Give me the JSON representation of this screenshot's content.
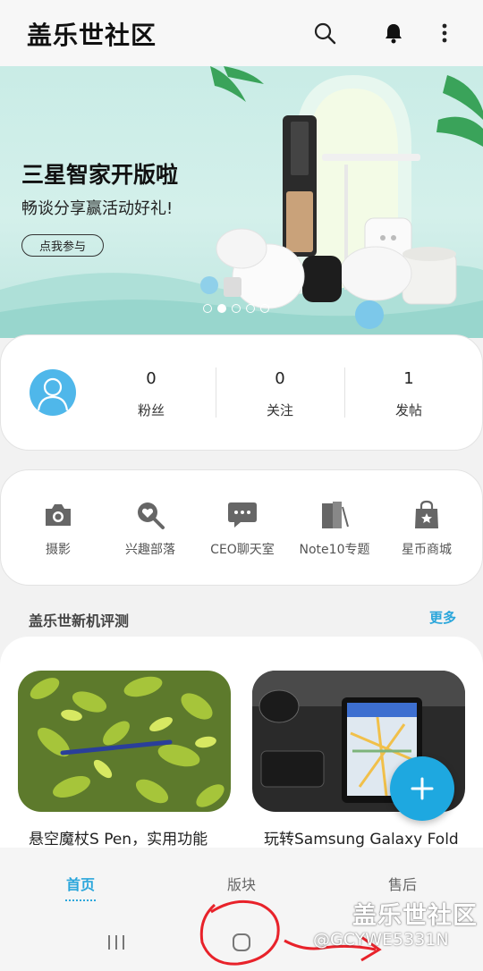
{
  "app": {
    "title": "盖乐世社区",
    "icons": [
      "search-icon",
      "bell-icon",
      "more-vertical-icon"
    ]
  },
  "banner": {
    "title": "三星智家开版啦",
    "subtitle": "畅谈分享赢活动好礼!",
    "cta": "点我参与",
    "slides_total": 5,
    "slide_active": 2
  },
  "profile": {
    "stats": [
      {
        "value": "0",
        "label": "粉丝"
      },
      {
        "value": "0",
        "label": "关注"
      },
      {
        "value": "1",
        "label": "发帖"
      }
    ]
  },
  "shortcuts": [
    {
      "label": "摄影",
      "icon": "camera-icon"
    },
    {
      "label": "兴趣部落",
      "icon": "heart-search-icon"
    },
    {
      "label": "CEO聊天室",
      "icon": "chat-bubble-icon"
    },
    {
      "label": "Note10专题",
      "icon": "note-pages-icon"
    },
    {
      "label": "星币商城",
      "icon": "shopping-bag-star-icon"
    }
  ],
  "reviews": {
    "section_title": "盖乐世新机评测",
    "more_label": "更多",
    "items": [
      {
        "caption": "悬空魔杖S Pen，实用功能"
      },
      {
        "caption": "玩转Samsung Galaxy Fold"
      }
    ]
  },
  "bottom_tabs": [
    {
      "label": "首页",
      "active": true
    },
    {
      "label": "版块",
      "active": false
    },
    {
      "label": "售后",
      "active": false
    }
  ],
  "watermark": {
    "line1": "盖乐世社区",
    "line2": "@GCYWE5331N"
  },
  "colors": {
    "accent": "#2aa6db",
    "fab": "#1ea8e0",
    "avatar": "#4fb7ea",
    "annotation": "#e8222a"
  }
}
